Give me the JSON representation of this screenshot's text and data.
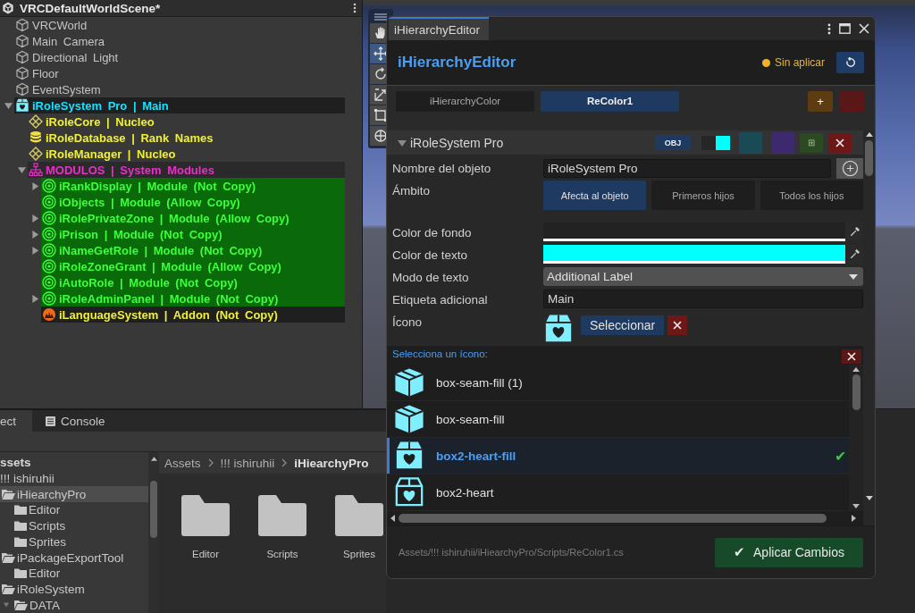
{
  "hierarchy": {
    "scene_title": "VRCDefaultWorldScene*",
    "rows": [
      {
        "label": "VRCWorld",
        "kind": "gameobject",
        "color": "#c4c4c4"
      },
      {
        "label": "Main Camera",
        "kind": "gameobject",
        "color": "#c4c4c4"
      },
      {
        "label": "Directional Light",
        "kind": "gameobject",
        "color": "#c4c4c4"
      },
      {
        "label": "Floor",
        "kind": "gameobject",
        "color": "#c4c4c4"
      },
      {
        "label": "EventSystem",
        "kind": "gameobject",
        "color": "#c4c4c4"
      },
      {
        "label": "iRoleSystem Pro | Main",
        "kind": "package",
        "expanded": true,
        "color": "#19e0ff",
        "children": [
          {
            "label": "iRoleCore | Nucleo",
            "kind": "core",
            "color": "#f0f03a"
          },
          {
            "label": "iRoleDatabase | Rank Names",
            "kind": "database",
            "color": "#f0f03a"
          },
          {
            "label": "iRoleManager | Nucleo",
            "kind": "core",
            "color": "#f0f03a"
          },
          {
            "label": "MODULOS | System Modules",
            "kind": "hierarchy",
            "expanded": true,
            "color": "#ea2fc9",
            "children": [
              {
                "label": "iRankDisplay | Module (Not Copy)",
                "kind": "module",
                "expanded": false,
                "color": "#3cff3c"
              },
              {
                "label": "iObjects | Module (Allow Copy)",
                "kind": "module",
                "color": "#3cff3c"
              },
              {
                "label": "iRolePrivateZone | Module (Allow Copy)",
                "kind": "module",
                "expanded": false,
                "color": "#3cff3c"
              },
              {
                "label": "iPrison | Module (Not Copy)",
                "kind": "module",
                "expanded": false,
                "color": "#3cff3c"
              },
              {
                "label": "iNameGetRole | Module (Not Copy)",
                "kind": "module",
                "expanded": false,
                "color": "#3cff3c"
              },
              {
                "label": "iRoleZoneGrant | Module (Allow Copy)",
                "kind": "module",
                "color": "#3cff3c"
              },
              {
                "label": "iAutoRole | Module (Not Copy)",
                "kind": "module",
                "color": "#3cff3c"
              },
              {
                "label": "iRoleAdminPanel | Module (Not Copy)",
                "kind": "module",
                "expanded": false,
                "color": "#3cff3c"
              },
              {
                "label": "iLanguageSystem | Addon (Not Copy)",
                "kind": "addon",
                "color": "#f0f03a"
              }
            ]
          }
        ]
      }
    ]
  },
  "project": {
    "tabs": [
      {
        "label": "ect",
        "selected": true
      },
      {
        "label": "Console",
        "selected": false
      }
    ],
    "tree": [
      {
        "label": "ssets",
        "selected": false,
        "children": [
          {
            "label": "!!! ishiruhii",
            "selected": false,
            "children": [
              {
                "label": "iHiearchyPro",
                "expanded": true,
                "selected": true,
                "children": [
                  {
                    "label": "Editor",
                    "expanded": false,
                    "selected": false
                  },
                  {
                    "label": "Scripts",
                    "expanded": false,
                    "selected": false
                  },
                  {
                    "label": "Sprites",
                    "expanded": false,
                    "selected": false
                  }
                ]
              },
              {
                "label": "iPackageExportTool",
                "expanded": true,
                "selected": false,
                "children": [
                  {
                    "label": "Editor",
                    "expanded": false,
                    "selected": false
                  }
                ]
              },
              {
                "label": "iRoleSystem",
                "expanded": true,
                "selected": false,
                "children": [
                  {
                    "label": "DATA",
                    "expanded": true,
                    "selected": false
                  }
                ]
              }
            ]
          }
        ]
      }
    ],
    "breadcrumb": [
      "Assets",
      "!!! ishiruhii",
      "iHiearchyPro"
    ],
    "folders": [
      "Editor",
      "Scripts",
      "Sprites"
    ]
  },
  "scene": {
    "tools": [
      {
        "kind": "hand",
        "selected": false
      },
      {
        "kind": "move",
        "selected": true
      },
      {
        "kind": "rotate",
        "selected": false
      },
      {
        "kind": "scale",
        "selected": false
      },
      {
        "kind": "rect",
        "selected": false
      },
      {
        "kind": "transform",
        "selected": false
      }
    ]
  },
  "editor": {
    "window_tab": "iHierarchyEditor",
    "title": "iHierarchyEditor",
    "status": "Sin aplicar",
    "tabs": [
      {
        "label": "iHierarchyColor",
        "selected": false
      },
      {
        "label": "ReColor1",
        "selected": true
      }
    ],
    "add_button": "+",
    "section": {
      "title": "iRoleSystem Pro",
      "expanded": true,
      "obj_button": "OBJ",
      "swatches": [
        {
          "color": "#262626"
        },
        {
          "color": "#00ffff"
        }
      ],
      "presets": [
        {
          "color": "#1a4a55"
        },
        {
          "color": "#3d2a6e"
        }
      ],
      "grid_button": "⊞",
      "fields": [
        {
          "kind": "text",
          "label": "Nombre del objeto",
          "value": "iRoleSystem Pro"
        },
        {
          "kind": "segmented",
          "label": "Ámbito",
          "options": [
            {
              "label": "Afecta al objeto",
              "selected": true
            },
            {
              "label": "Primeros hijos",
              "selected": false
            },
            {
              "label": "Todos los hijos",
              "selected": false
            }
          ]
        },
        {
          "kind": "color",
          "label": "Color de fondo",
          "color": "#222222"
        },
        {
          "kind": "color",
          "label": "Color de texto",
          "color": "#00ffff"
        },
        {
          "kind": "dropdown",
          "label": "Modo de texto",
          "value": "Additional Label"
        },
        {
          "kind": "text",
          "label": "Etiqueta adicional",
          "value": "Main"
        },
        {
          "kind": "icon",
          "label": "Ícono",
          "button": "Seleccionar"
        }
      ]
    },
    "picker": {
      "title": "Selecciona un ícono:",
      "items": [
        {
          "label": "box-seam-fill (1)",
          "kind": "box",
          "selected": false
        },
        {
          "label": "box-seam-fill",
          "kind": "box",
          "selected": false
        },
        {
          "label": "box2-heart-fill",
          "kind": "heart-box",
          "selected": true
        },
        {
          "label": "box2-heart",
          "kind": "heart-box-outline",
          "selected": false
        }
      ]
    },
    "path": "Assets/!!! ishiruhii/iHiearchyPro/Scripts/ReColor1.cs",
    "apply_button": "Aplicar Cambios",
    "apply_check": "✔",
    "selected_check": "✔"
  }
}
